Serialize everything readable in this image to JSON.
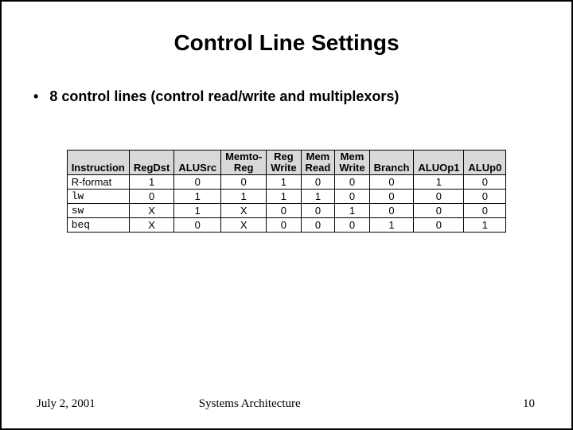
{
  "title": "Control Line Settings",
  "bullet": "8 control lines (control read/write and multiplexors)",
  "table": {
    "headers": {
      "instruction": "Instruction",
      "regdst": "RegDst",
      "alusrc": "ALUSrc",
      "memtoreg_top": "Memto-",
      "memtoreg_bot": "Reg",
      "regwrite_top": "Reg",
      "regwrite_bot": "Write",
      "memread_top": "Mem",
      "memread_bot": "Read",
      "memwrite_top": "Mem",
      "memwrite_bot": "Write",
      "branch": "Branch",
      "aluop1": "ALUOp1",
      "aluop0": "ALUp0"
    },
    "rows": [
      {
        "instr": "R-format",
        "mono": false,
        "regdst": "1",
        "alusrc": "0",
        "memtoreg": "0",
        "regwrite": "1",
        "memread": "0",
        "memwrite": "0",
        "branch": "0",
        "aluop1": "1",
        "aluop0": "0"
      },
      {
        "instr": "lw",
        "mono": true,
        "regdst": "0",
        "alusrc": "1",
        "memtoreg": "1",
        "regwrite": "1",
        "memread": "1",
        "memwrite": "0",
        "branch": "0",
        "aluop1": "0",
        "aluop0": "0"
      },
      {
        "instr": "sw",
        "mono": true,
        "regdst": "X",
        "alusrc": "1",
        "memtoreg": "X",
        "regwrite": "0",
        "memread": "0",
        "memwrite": "1",
        "branch": "0",
        "aluop1": "0",
        "aluop0": "0"
      },
      {
        "instr": "beq",
        "mono": true,
        "regdst": "X",
        "alusrc": "0",
        "memtoreg": "X",
        "regwrite": "0",
        "memread": "0",
        "memwrite": "0",
        "branch": "1",
        "aluop1": "0",
        "aluop0": "1"
      }
    ]
  },
  "footer": {
    "date": "July 2, 2001",
    "center": "Systems Architecture",
    "page": "10"
  }
}
